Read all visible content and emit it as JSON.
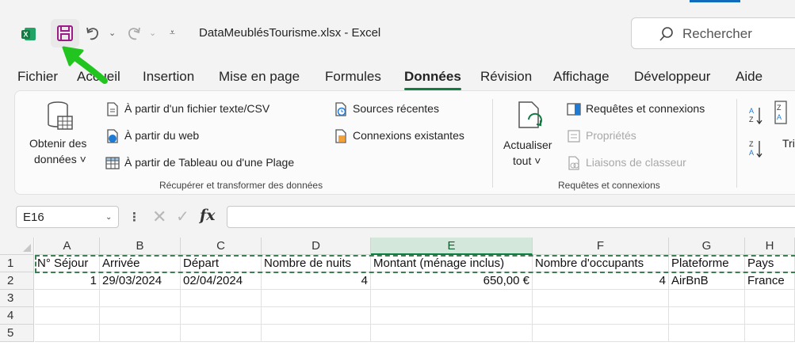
{
  "titlebar": {
    "file_title": "DataMeublésTourisme.xlsx - Excel",
    "search_placeholder": "Rechercher",
    "accent": "#107c41"
  },
  "tabs": [
    {
      "label": "Fichier",
      "active": false
    },
    {
      "label": "Accueil",
      "active": false
    },
    {
      "label": "Insertion",
      "active": false
    },
    {
      "label": "Mise en page",
      "active": false
    },
    {
      "label": "Formules",
      "active": false
    },
    {
      "label": "Données",
      "active": true
    },
    {
      "label": "Révision",
      "active": false
    },
    {
      "label": "Affichage",
      "active": false
    },
    {
      "label": "Développeur",
      "active": false
    },
    {
      "label": "Aide",
      "active": false
    }
  ],
  "ribbon": {
    "get_data": {
      "line1": "Obtenir des",
      "line2": "données ˅"
    },
    "from_text_csv": "À partir d'un fichier texte/CSV",
    "from_web": "À partir du web",
    "from_table": "À partir de Tableau ou d'une Plage",
    "recent_sources": "Sources récentes",
    "existing_connections": "Connexions existantes",
    "group1_label": "Récupérer et transformer des données",
    "refresh": {
      "line1": "Actualiser",
      "line2": "tout ˅"
    },
    "queries_connections": "Requêtes et connexions",
    "properties": "Propriétés",
    "workbook_links": "Liaisons de classeur",
    "group2_label": "Requêtes et connexions",
    "sort_partial": "Tri"
  },
  "formula_bar": {
    "name_box": "E16",
    "fx": "fx",
    "formula": ""
  },
  "grid": {
    "columns": [
      "A",
      "B",
      "C",
      "D",
      "E",
      "F",
      "G",
      "H"
    ],
    "selected_column": "E",
    "rows": [
      "1",
      "2",
      "3",
      "4",
      "5"
    ],
    "header_row": [
      "N° Séjour",
      "Arrivée",
      "Départ",
      "Nombre de nuits",
      "Montant (ménage inclus)",
      "Nombre d'occupants",
      "Plateforme",
      "Pays"
    ],
    "data_row": [
      "1",
      "29/03/2024",
      "02/04/2024",
      "4",
      "650,00 €",
      "4",
      "AirBnB",
      "France"
    ]
  }
}
